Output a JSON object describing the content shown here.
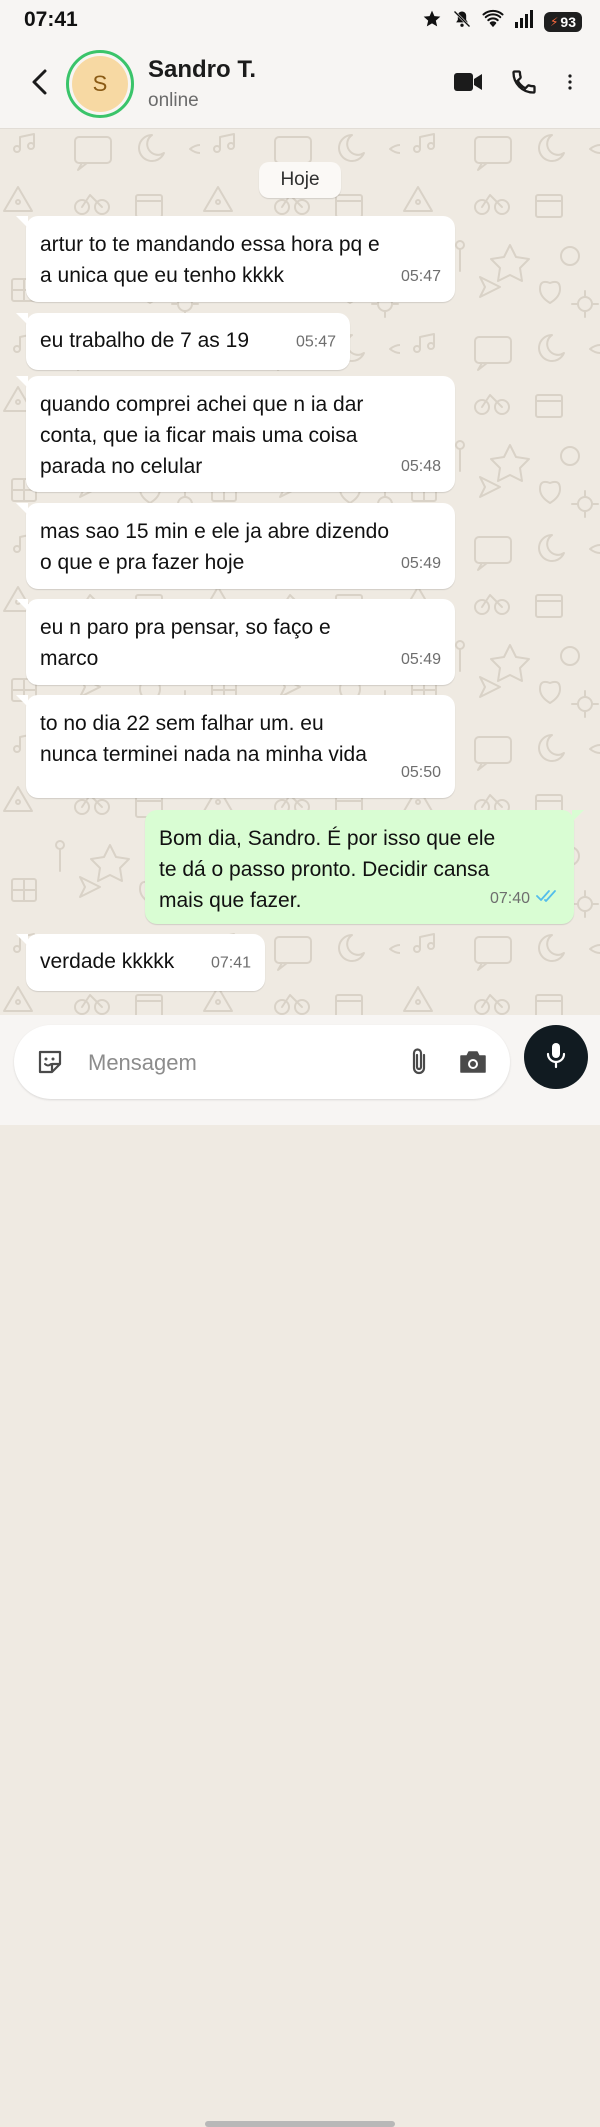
{
  "status_bar": {
    "time": "07:41",
    "battery": "93",
    "icons": [
      "star-icon",
      "bell-off-icon",
      "wifi-icon",
      "signal-icon",
      "battery-icon"
    ]
  },
  "header": {
    "avatar_initial": "S",
    "contact_name": "Sandro T.",
    "status": "online",
    "icons": [
      "back-arrow-icon",
      "video-call-icon",
      "phone-call-icon",
      "more-vert-icon"
    ]
  },
  "chat": {
    "date_chip": "Hoje",
    "messages": [
      {
        "direction": "in",
        "text": "artur to te mandando essa hora pq e\na unica que eu tenho kkkk",
        "time": "05:47"
      },
      {
        "direction": "in",
        "text": "eu trabalho de 7 as 19",
        "time": "05:47"
      },
      {
        "direction": "in",
        "text": "quando comprei achei que n ia dar\nconta, que ia ficar mais uma coisa\nparada no celular",
        "time": "05:48"
      },
      {
        "direction": "in",
        "text": "mas sao 15 min e ele ja abre dizendo\no que e pra fazer hoje",
        "time": "05:49"
      },
      {
        "direction": "in",
        "text": "eu n paro pra pensar, so faço e\nmarco",
        "time": "05:49"
      },
      {
        "direction": "in",
        "text": "to no dia 22 sem falhar um. eu\nnunca terminei nada na minha vida",
        "time": "05:50"
      },
      {
        "direction": "out",
        "text": "Bom dia, Sandro. É por isso que ele\nte dá o passo pronto. Decidir cansa\nmais que fazer.",
        "time": "07:40",
        "read": true
      },
      {
        "direction": "in",
        "text": "verdade kkkkk",
        "time": "07:41"
      }
    ]
  },
  "input": {
    "placeholder": "Mensagem",
    "icons": [
      "sticker-icon",
      "attach-icon",
      "camera-icon",
      "mic-icon"
    ]
  },
  "colors": {
    "chat_background": "#efeae2",
    "incoming_bubble": "#ffffff",
    "outgoing_bubble": "#d9fdd3",
    "read_ticks": "#53bdeb",
    "online_ring": "#3ac46a",
    "mic_button": "#111b21"
  }
}
